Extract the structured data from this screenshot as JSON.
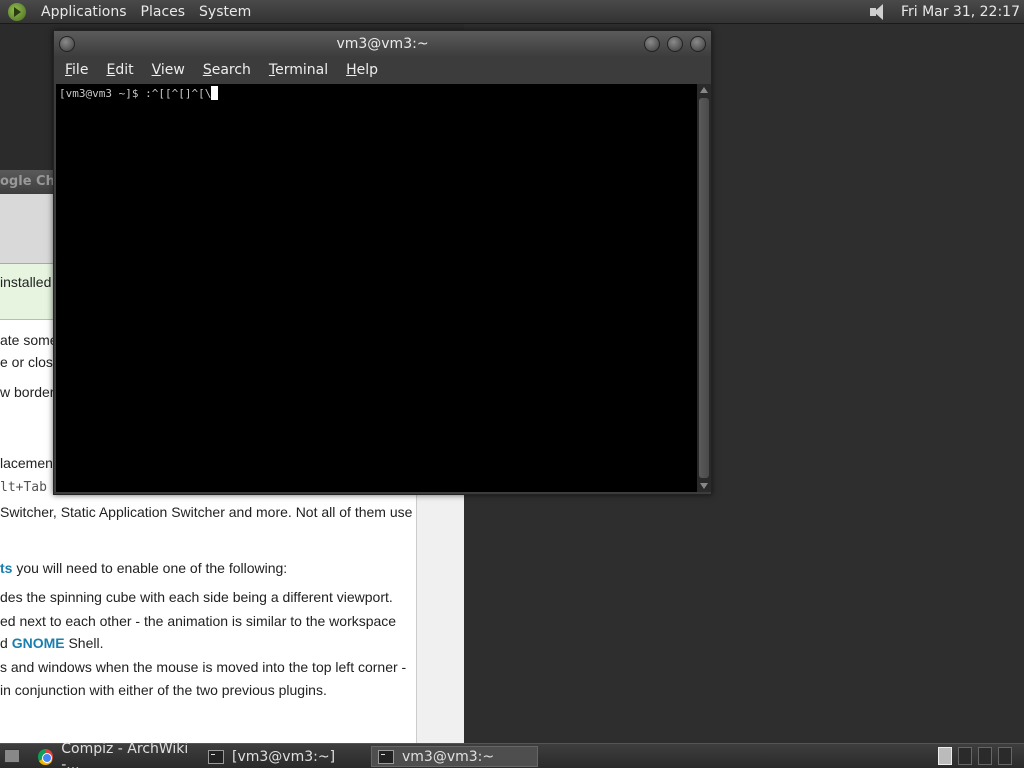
{
  "top_panel": {
    "menus": [
      "Applications",
      "Places",
      "System"
    ],
    "clock": "Fri Mar 31, 22:17"
  },
  "background_window": {
    "title_fragment": "ogle Chro",
    "lines": [
      "installed",
      "ate some",
      "e or clos",
      "w border",
      "lacemen",
      "lt+Tab",
      "Switcher, Static Application Switcher and more. Not all of them use",
      "you will need to enable one of the following:",
      "des the spinning cube with each side being a different viewport.",
      "ed next to each other - the animation is similar to the workspace",
      "Shell.",
      "s and windows when the mouse is moved into the top left corner -",
      " in conjunction with either of the two previous plugins."
    ],
    "link_ts": "ts",
    "link_prefix": "d ",
    "link_gnome": "GNOME"
  },
  "terminal": {
    "title": "vm3@vm3:~",
    "menus": [
      {
        "accel": "F",
        "rest": "ile"
      },
      {
        "accel": "E",
        "rest": "dit"
      },
      {
        "accel": "V",
        "rest": "iew"
      },
      {
        "accel": "S",
        "rest": "earch"
      },
      {
        "accel": "T",
        "rest": "erminal"
      },
      {
        "accel": "H",
        "rest": "elp"
      }
    ],
    "prompt_line": "[vm3@vm3 ~]$ :^[[^[]^[\\"
  },
  "taskbar": {
    "tasks": [
      {
        "label": "Compiz - ArchWiki -..."
      },
      {
        "label": "[vm3@vm3:~]"
      },
      {
        "label": "vm3@vm3:~"
      }
    ]
  }
}
